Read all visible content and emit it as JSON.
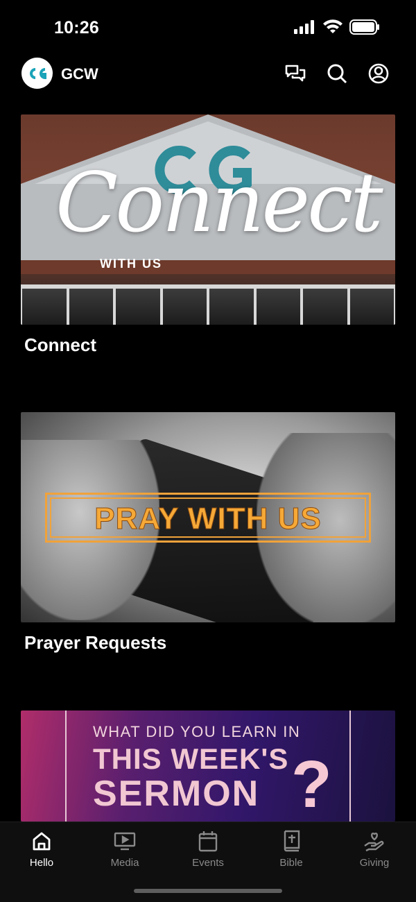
{
  "status_bar": {
    "time": "10:26"
  },
  "header": {
    "title": "GCW",
    "icons": [
      "chat-icon",
      "search-icon",
      "account-icon"
    ]
  },
  "cards": [
    {
      "title": "Connect",
      "image_text": {
        "script": "Connect",
        "sub": "WITH US"
      }
    },
    {
      "title": "Prayer Requests",
      "image_text": {
        "banner": "PRAY WITH US"
      }
    },
    {
      "title": "",
      "image_text": {
        "line1": "WHAT DID YOU LEARN IN",
        "line2": "THIS WEEK'S",
        "line3": "SERMON",
        "mark": "?"
      }
    }
  ],
  "tabs": [
    {
      "label": "Hello",
      "icon": "home-icon",
      "active": true
    },
    {
      "label": "Media",
      "icon": "media-icon",
      "active": false
    },
    {
      "label": "Events",
      "icon": "calendar-icon",
      "active": false
    },
    {
      "label": "Bible",
      "icon": "bible-icon",
      "active": false
    },
    {
      "label": "Giving",
      "icon": "giving-icon",
      "active": false
    }
  ],
  "colors": {
    "background": "#000000",
    "accent": "#1aa3b8",
    "pray_orange": "#f6a937",
    "tab_inactive": "#8a8a8a"
  }
}
